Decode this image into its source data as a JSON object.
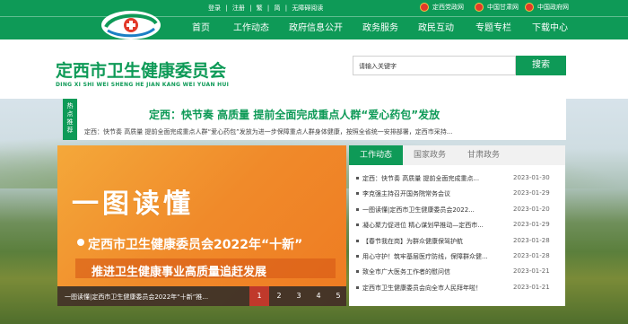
{
  "utility_links": [
    "登录",
    "|",
    "注册",
    "|",
    "繁",
    "|",
    "简",
    "|",
    "无障碍阅读"
  ],
  "gov_links": [
    "定西党政网",
    "中国甘肃网",
    "中国政府网"
  ],
  "nav": [
    "首页",
    "工作动态",
    "政府信息公开",
    "政务服务",
    "政民互动",
    "专题专栏",
    "下载中心"
  ],
  "site": {
    "title": "定西市卫生健康委员会",
    "pinyin": "DING XI SHI WEI SHENG HE JIAN KANG WEI YUAN HUI"
  },
  "search": {
    "placeholder": "请输入关键字",
    "button": "搜索"
  },
  "headline": {
    "tag": [
      "热",
      "点",
      "推",
      "荐"
    ],
    "title": "定西：快节奏 高质量 提前全面完成重点人群“爱心药包”发放",
    "summary": "定西：快节奏 高质量 提前全面完成重点人群“爱心药包”发放为进一步保障重点人群身体健康，按照全省统一安排部署，定西市采持..."
  },
  "slider": {
    "heading": "一图读懂",
    "line1": "定西市卫生健康委员会2022年“十新”",
    "line2": "推进卫生健康事业高质量追赶发展",
    "caption": "一图读懂|定西市卫生健康委员会2022年“十新”推...",
    "pages": [
      "1",
      "2",
      "3",
      "4",
      "5"
    ]
  },
  "news": {
    "tabs": [
      "工作动态",
      "国家政务",
      "甘肃政务"
    ],
    "items": [
      {
        "title": "定西：快节奏 高质量 提前全面完成重点...",
        "date": "2023-01-30"
      },
      {
        "title": "李克强主持召开国务院常务会议",
        "date": "2023-01-29"
      },
      {
        "title": "一图读懂|定西市卫生健康委员会2022...",
        "date": "2023-01-20"
      },
      {
        "title": "凝心聚力促进位 精心谋划早推动—定西市...",
        "date": "2023-01-29"
      },
      {
        "title": "【春节我在岗】为群众健康保驾护航",
        "date": "2023-01-28"
      },
      {
        "title": "用心守护！筑牢基层医疗防线，保障群众健...",
        "date": "2023-01-28"
      },
      {
        "title": "致全市广大医务工作者的慰问信",
        "date": "2023-01-21"
      },
      {
        "title": "定西市卫生健康委员会向全市人民拜年啦！",
        "date": "2023-01-21"
      }
    ]
  },
  "colors": {
    "brand_green": "#0e9a57",
    "active_page": "#c0392b",
    "slider_orange": "#f08a2a"
  }
}
